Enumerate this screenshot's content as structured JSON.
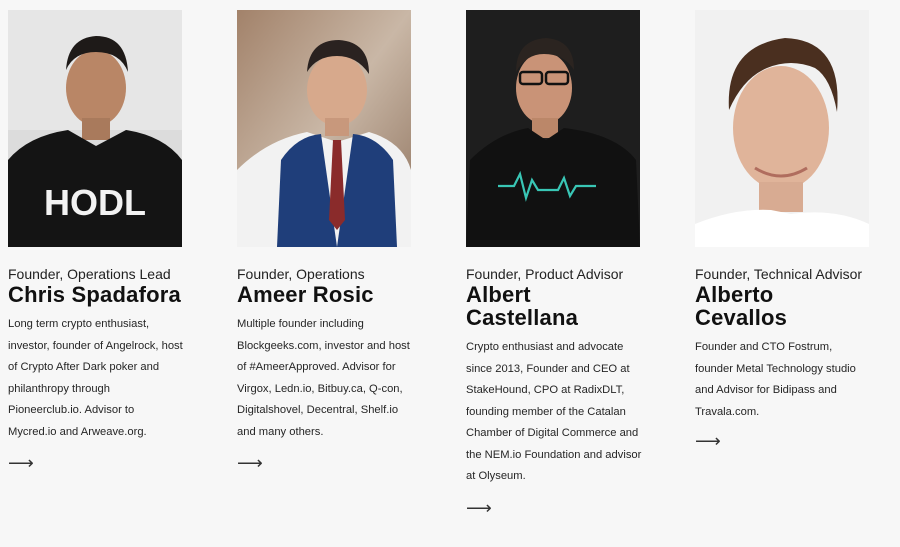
{
  "team": [
    {
      "role": "Founder, Operations Lead",
      "name": "Chris Spadafora",
      "bio": "Long term crypto enthusiast, investor, founder of Angelrock, host of Crypto After Dark poker and philanthropy through Pioneerclub.io. Advisor to Mycred.io and Arweave.org.",
      "shirt_text": "HODL",
      "more_label": "⟶"
    },
    {
      "role": "Founder, Operations",
      "name": "Ameer Rosic",
      "bio": "Multiple founder including Blockgeeks.com, investor and host of #AmeerApproved. Advisor for Virgox, Ledn.io, Bitbuy.ca, Q-con, Digitalshovel, Decentral, Shelf.io and many others.",
      "more_label": "⟶"
    },
    {
      "role": "Founder, Product Advisor",
      "name": "Albert Castellana",
      "bio": "Crypto enthusiast and advocate since 2013, Founder and CEO at StakeHound, CPO at RadixDLT, founding member of the Catalan Chamber of Digital Commerce and the NEM.io Foundation and advisor at Olyseum.",
      "more_label": "⟶"
    },
    {
      "role": "Founder, Technical Advisor",
      "name": "Alberto Cevallos",
      "bio": "Founder and CTO Fostrum, founder Metal Technology studio and Advisor for Bidipass and Travala.com.",
      "more_label": "⟶"
    }
  ]
}
